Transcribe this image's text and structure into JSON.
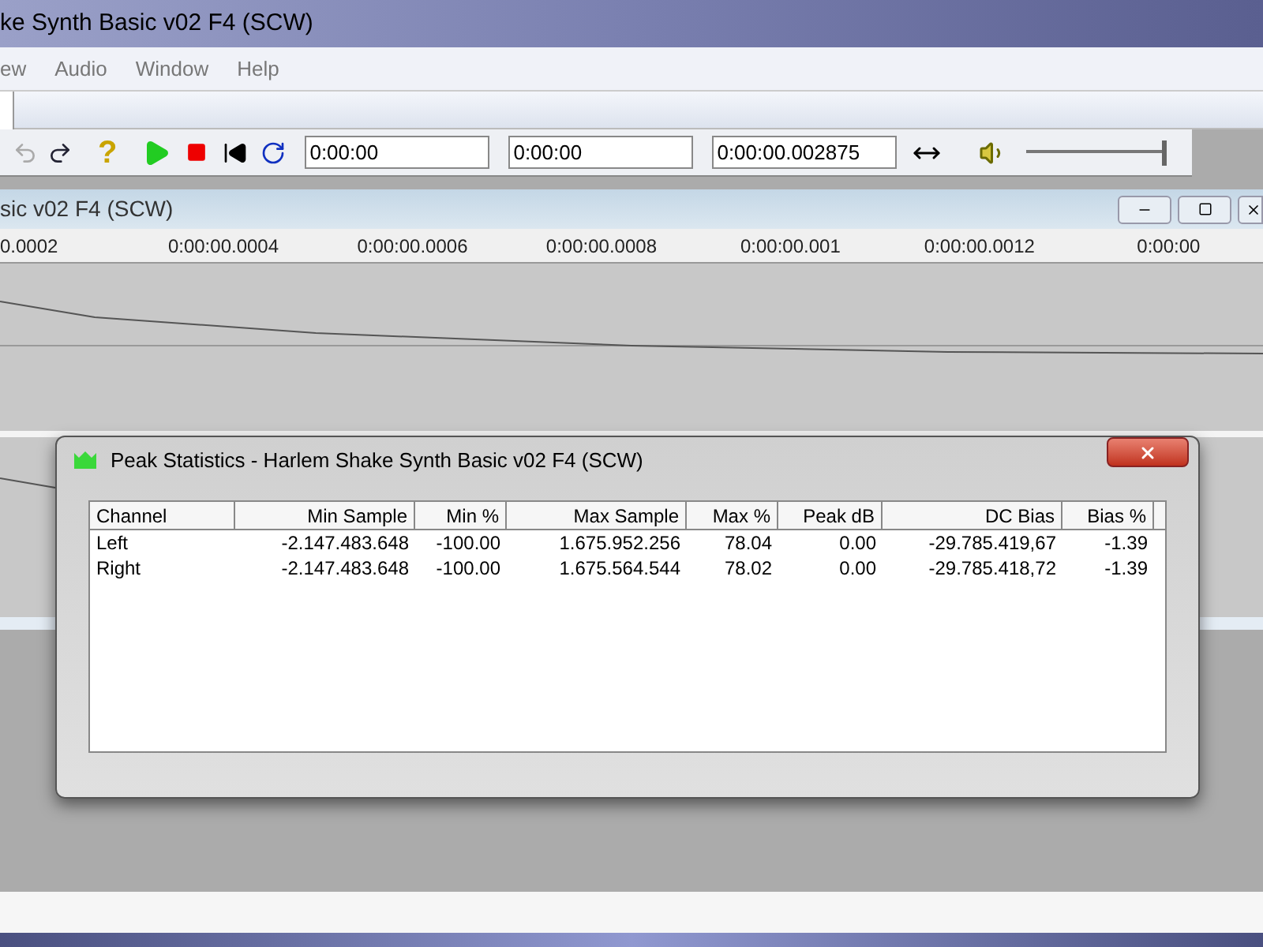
{
  "window": {
    "title": "ke Synth Basic v02 F4 (SCW)"
  },
  "menu": [
    "ew",
    "Audio",
    "Window",
    "Help"
  ],
  "toolbar": {
    "help_symbol": "?",
    "time_fields": [
      "0:00:00",
      "0:00:00",
      "0:00:00.002875"
    ],
    "volume": {
      "level": 1.0
    }
  },
  "document": {
    "title": "sic v02 F4 (SCW)",
    "ruler": [
      "0.0002",
      "0:00:00.0004",
      "0:00:00.0006",
      "0:00:00.0008",
      "0:00:00.001",
      "0:00:00.0012",
      "0:00:00"
    ]
  },
  "dialog": {
    "title": "Peak Statistics - Harlem Shake Synth Basic v02 F4 (SCW)",
    "columns": [
      "Channel",
      "Min Sample",
      "Min %",
      "Max Sample",
      "Max %",
      "Peak dB",
      "DC Bias",
      "Bias %"
    ],
    "rows": [
      [
        "Left",
        "-2.147.483.648",
        "-100.00",
        "1.675.952.256",
        "78.04",
        "0.00",
        "-29.785.419,67",
        "-1.39"
      ],
      [
        "Right",
        "-2.147.483.648",
        "-100.00",
        "1.675.564.544",
        "78.02",
        "0.00",
        "-29.785.418,72",
        "-1.39"
      ]
    ]
  }
}
